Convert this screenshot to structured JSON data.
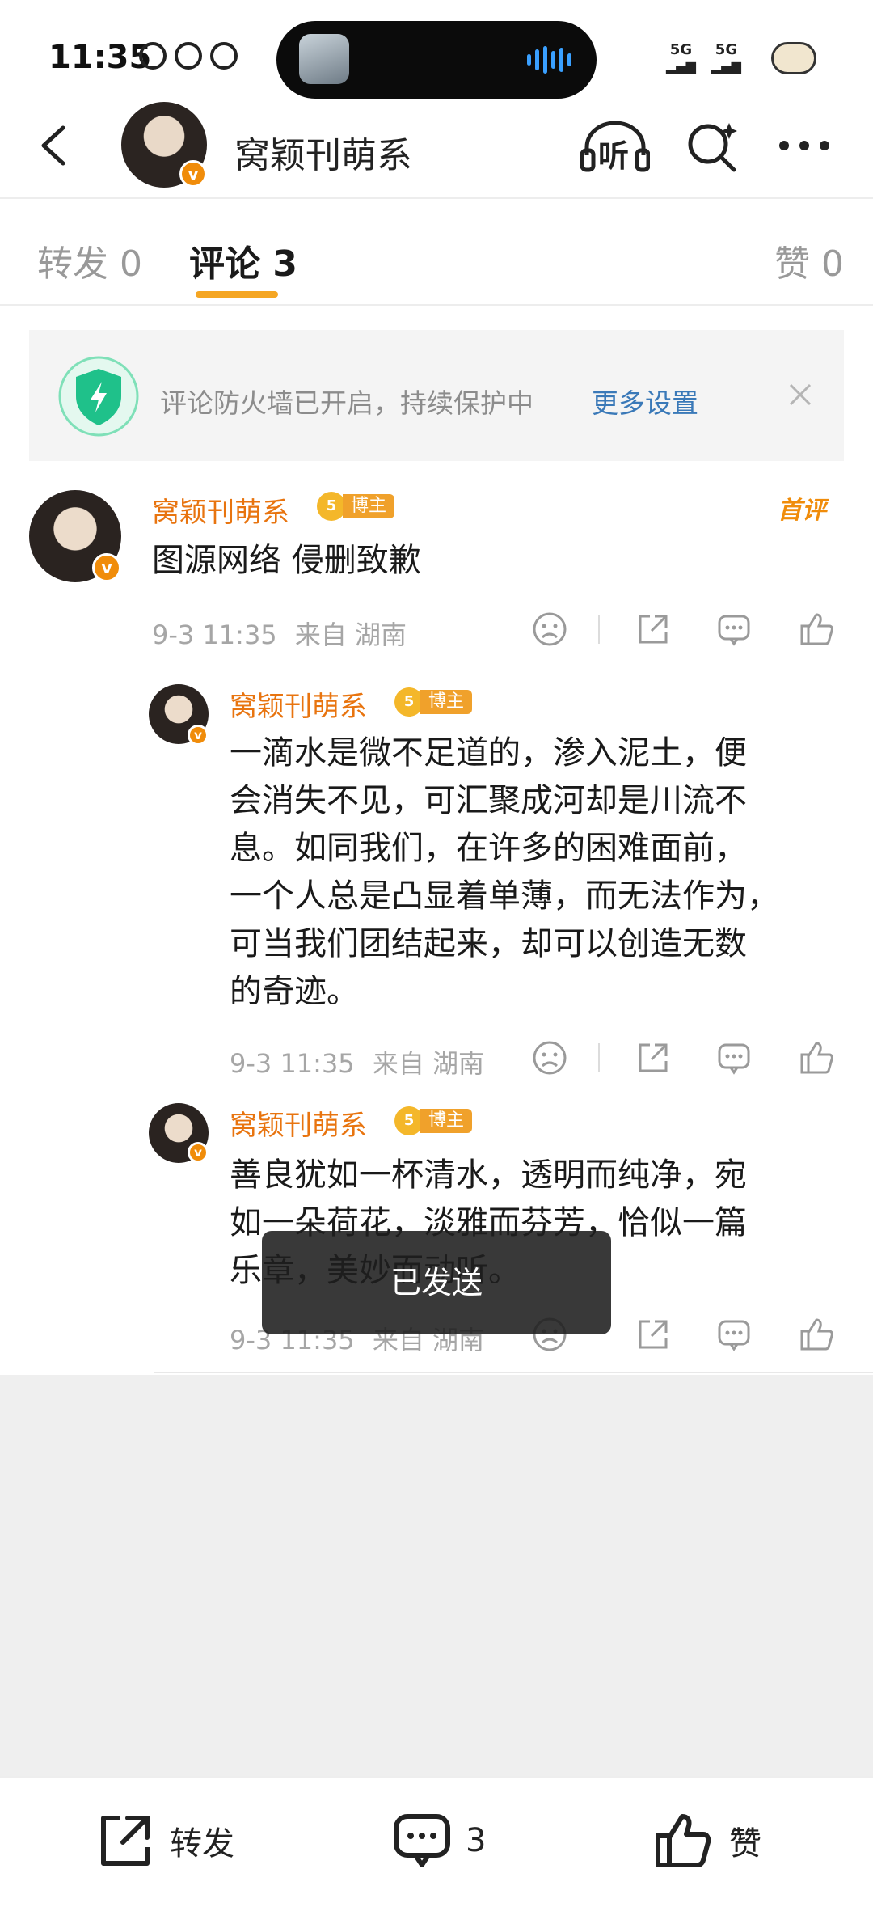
{
  "status_bar": {
    "time": "11:35",
    "signal_1": "5G",
    "signal_2": "5G"
  },
  "header": {
    "title": "窝颖刊萌系",
    "listen_label": "听"
  },
  "tabs": [
    {
      "label": "转发 0"
    },
    {
      "label": "评论 3"
    },
    {
      "label": "赞 0"
    }
  ],
  "firewall": {
    "text": "评论防火墙已开启，持续保护中",
    "link": "更多设置"
  },
  "comments": [
    {
      "name": "窝颖刊萌系",
      "level": "5",
      "badge": "博主",
      "first_tag": "首评",
      "text_lines": [
        "图源网络 侵删致歉"
      ],
      "date": "9-3 11:35",
      "location": "来自 湖南"
    },
    {
      "name": "窝颖刊萌系",
      "level": "5",
      "badge": "博主",
      "text_lines": [
        "一滴水是微不足道的，渗入泥土，便",
        "会消失不见，可汇聚成河却是川流不",
        "息。如同我们，在许多的困难面前，",
        "一个人总是凸显着单薄，而无法作为，",
        "可当我们团结起来，却可以创造无数",
        "的奇迹。"
      ],
      "date": "9-3 11:35",
      "location": "来自 湖南"
    },
    {
      "name": "窝颖刊萌系",
      "level": "5",
      "badge": "博主",
      "text_lines": [
        "善良犹如一杯清水，透明而纯净，宛",
        "如一朵荷花，淡雅而芬芳，恰似一篇",
        "乐章，美妙而动听。"
      ],
      "date": "9-3 11:35",
      "location": "来自 湖南"
    }
  ],
  "toast": "已发送",
  "bottom_bar": {
    "repost_label": "转发",
    "comment_count": "3",
    "like_label": "赞"
  },
  "colors": {
    "accent": "#f5a623",
    "name": "#e8740f",
    "link": "#3a79b8",
    "shield": "#1fc18a"
  }
}
